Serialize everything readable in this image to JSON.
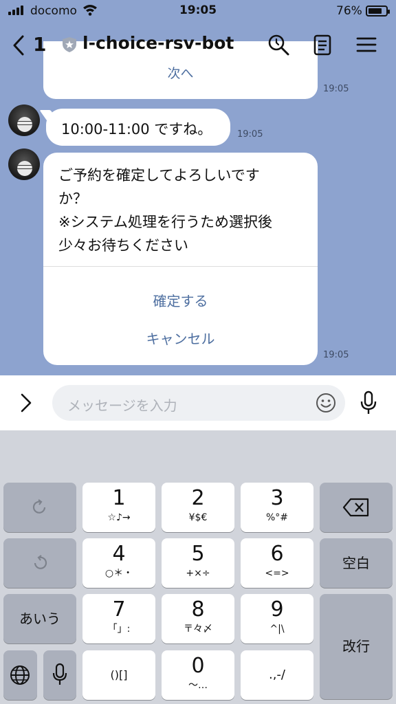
{
  "status_bar": {
    "carrier": "docomo",
    "time": "19:05",
    "battery": "76%",
    "battery_level": 0.76
  },
  "nav": {
    "back_count": "1",
    "title": "l-choice-rsv-bot",
    "icons": [
      "search-icon",
      "notes-icon",
      "menu-icon"
    ]
  },
  "messages": {
    "top_bubble": {
      "label": "次へ",
      "time": "19:05"
    },
    "user_reply": {
      "text": "10:00-11:00 ですね。",
      "time": "19:05"
    },
    "confirm": {
      "lines": [
        "ご予約を確定してよろしいです",
        "か？",
        "※システム処理を行うため選択後",
        "少々お待ちください"
      ],
      "confirm_label": "確定する",
      "cancel_label": "キャンセル",
      "time": "19:05"
    }
  },
  "input": {
    "placeholder": "メッセージを入力"
  },
  "keyboard": {
    "k1": {
      "main": "1",
      "sub": "☆♪→"
    },
    "k2": {
      "main": "2",
      "sub": "¥$€"
    },
    "k3": {
      "main": "3",
      "sub": "%°#"
    },
    "k4": {
      "main": "4",
      "sub": "○＊・"
    },
    "k5": {
      "main": "5",
      "sub": "+×÷"
    },
    "k6": {
      "main": "6",
      "sub": "<=>"
    },
    "k7": {
      "main": "7",
      "sub": "「」:"
    },
    "k8": {
      "main": "8",
      "sub": "〒々〆"
    },
    "k9": {
      "main": "9",
      "sub": "^|\\"
    },
    "k0": {
      "main": "0",
      "sub": "〜…"
    },
    "paren": "()[]",
    "punct": ".,-/",
    "aiu": "あいう",
    "space": "空白",
    "enter": "改行"
  },
  "colors": {
    "chat_bg": "#8da3cf",
    "link_blue": "#4e6fa0",
    "keyboard_bg": "#d1d4db",
    "fn_key": "#abb0bc"
  }
}
